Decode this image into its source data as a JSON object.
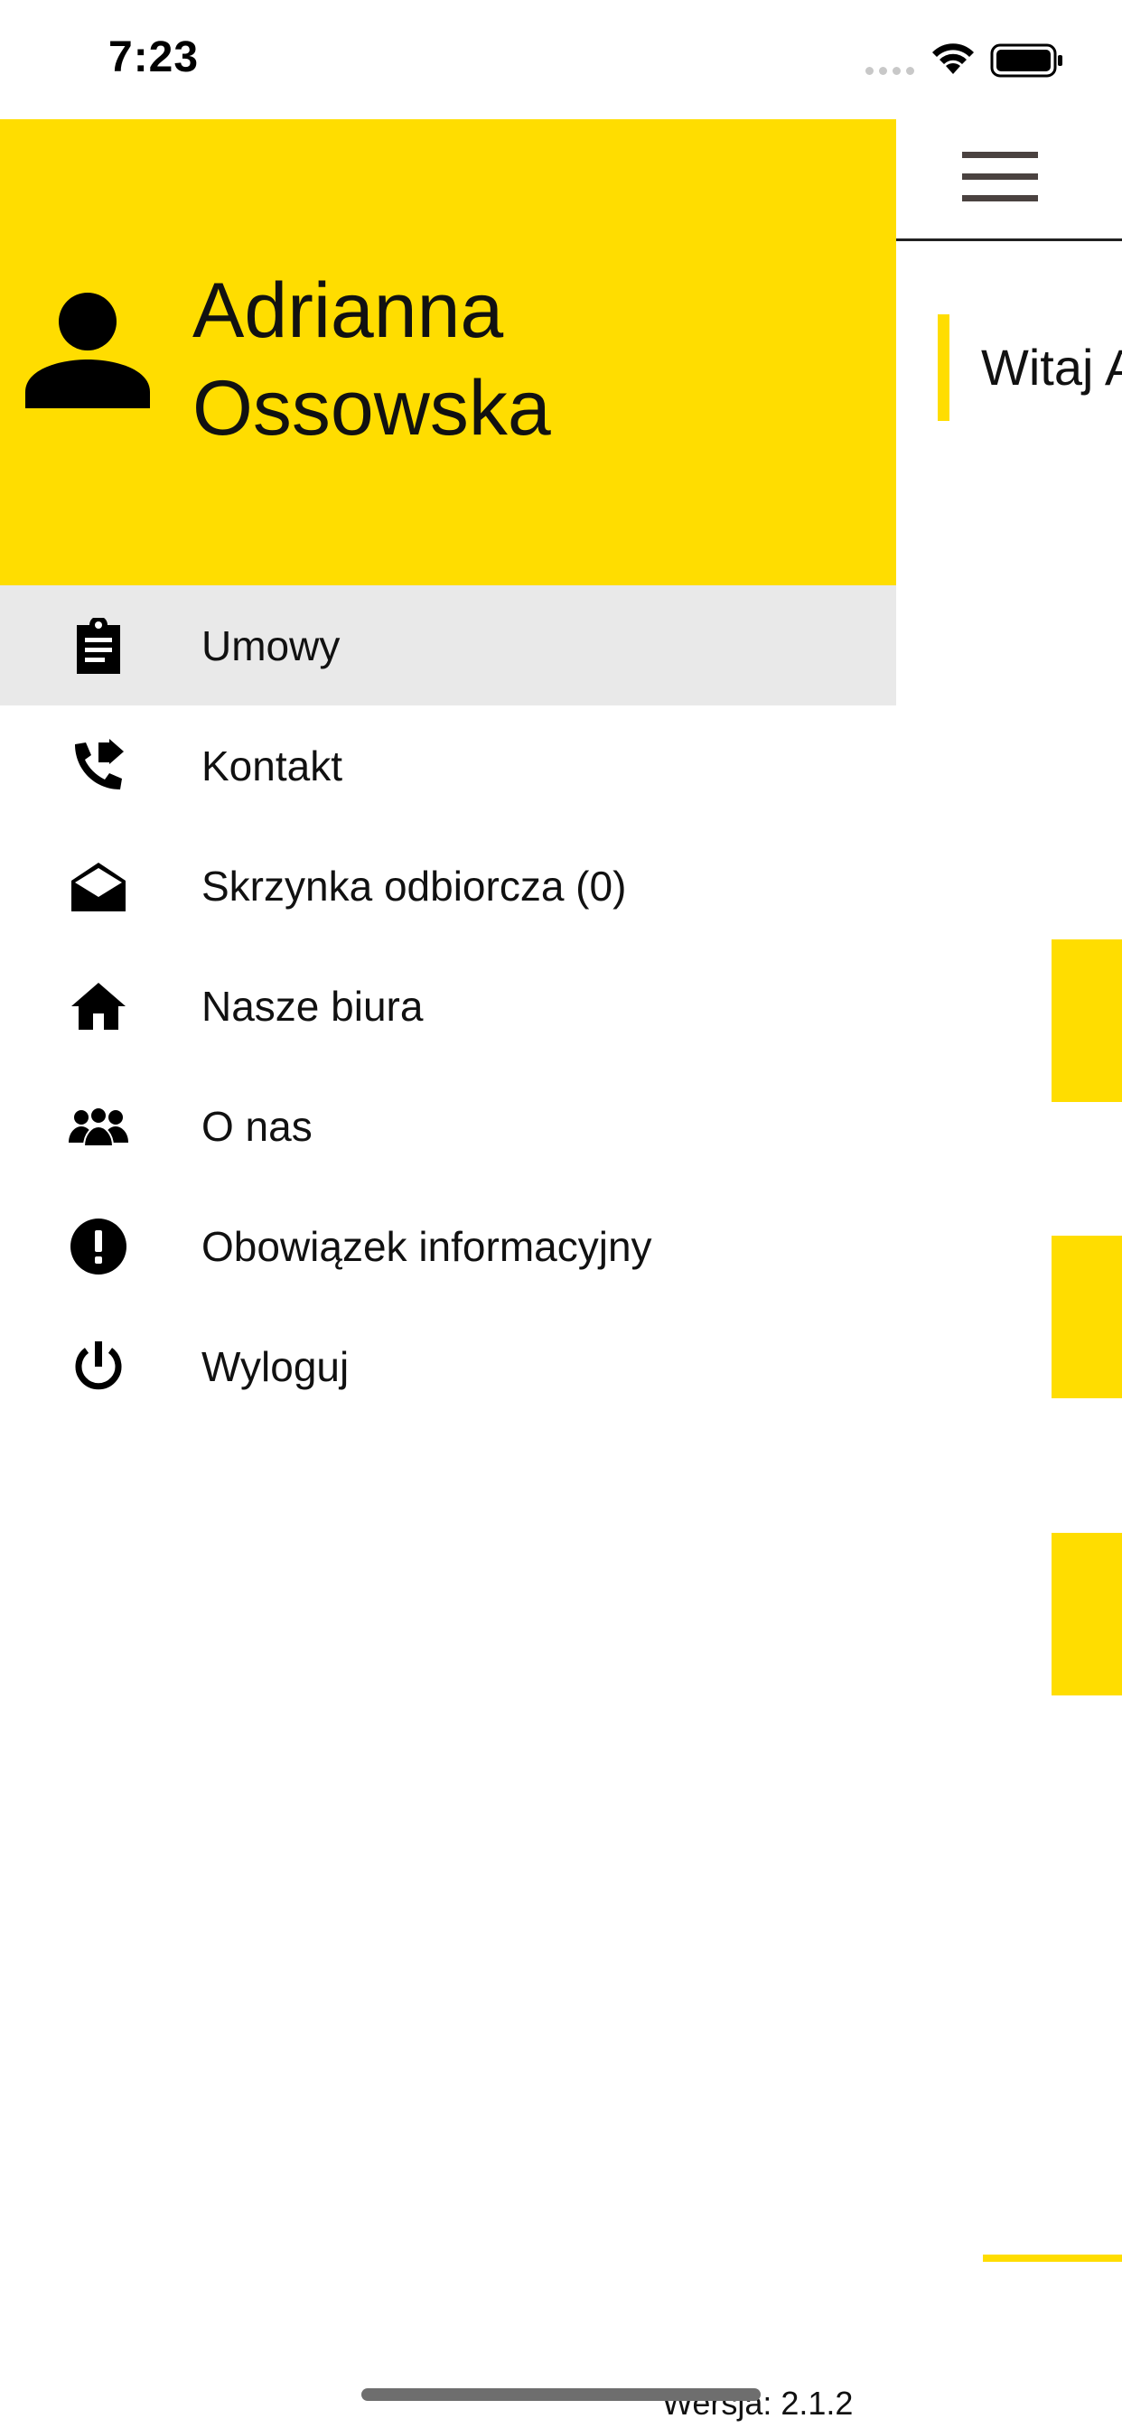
{
  "status_bar": {
    "time": "7:23"
  },
  "main": {
    "welcome_text": "Witaj A"
  },
  "drawer": {
    "user": {
      "first_name": "Adrianna",
      "last_name": "Ossowska"
    },
    "items": [
      {
        "label": "Umowy",
        "icon": "clipboard-icon",
        "active": true
      },
      {
        "label": "Kontakt",
        "icon": "phone-forward-icon",
        "active": false
      },
      {
        "label": "Skrzynka odbiorcza (0)",
        "icon": "open-envelope-icon",
        "active": false
      },
      {
        "label": "Nasze biura",
        "icon": "home-icon",
        "active": false
      },
      {
        "label": "O nas",
        "icon": "people-icon",
        "active": false
      },
      {
        "label": "Obowiązek informacyjny",
        "icon": "exclamation-icon",
        "active": false
      },
      {
        "label": "Wyloguj",
        "icon": "power-icon",
        "active": false
      }
    ],
    "version": "Wersja: 2.1.2"
  },
  "colors": {
    "accent": "#FFDD00",
    "active_item_bg": "#E9E9E9"
  }
}
